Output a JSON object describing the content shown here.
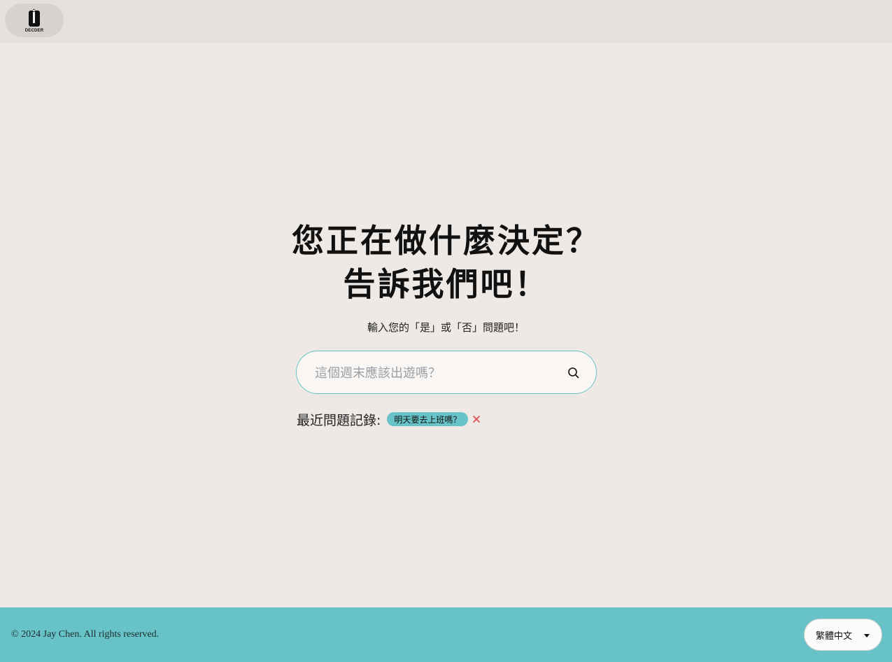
{
  "header": {
    "logo_text": "DECDER"
  },
  "hero": {
    "headline_line1": "您正在做什麼決定？",
    "headline_line2": "告訴我們吧！",
    "subtitle": "輸入您的「是」或「否」問題吧！"
  },
  "search": {
    "placeholder": "這個週末應該出遊嗎？",
    "value": "",
    "icon": "search-icon"
  },
  "history": {
    "label": "最近問題記錄:",
    "items": [
      {
        "text": "明天要去上班嗎？"
      }
    ],
    "remove_icon": "close-icon"
  },
  "footer": {
    "copyright": "© 2024 Jay Chen. All rights reserved.",
    "language": "繁體中文"
  },
  "colors": {
    "background": "#eee9e5",
    "topbar": "#e6e1de",
    "accent": "#67c3c8",
    "remove": "#e05050"
  }
}
